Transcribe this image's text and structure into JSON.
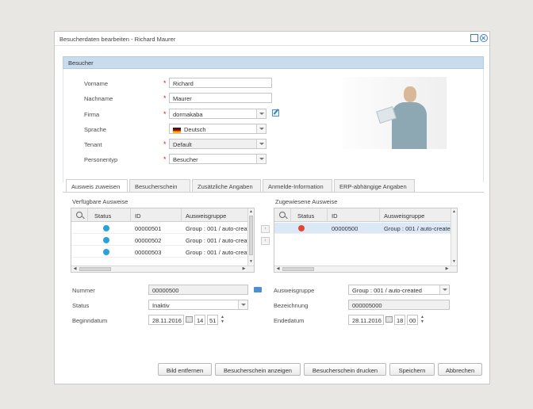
{
  "dialog": {
    "title": "Besucherdaten bearbeiten - Richard Maurer"
  },
  "section": {
    "title": "Besucher"
  },
  "form": {
    "vorname_label": "Vorname",
    "vorname_value": "Richard",
    "nachname_label": "Nachname",
    "nachname_value": "Maurer",
    "firma_label": "Firma",
    "firma_value": "dormakaba",
    "sprache_label": "Sprache",
    "sprache_value": "Deutsch",
    "tenant_label": "Tenant",
    "tenant_value": "Default",
    "personentyp_label": "Personentyp",
    "personentyp_value": "Besucher",
    "required_mark": "*"
  },
  "tabs": [
    {
      "label": "Ausweis zuweisen"
    },
    {
      "label": "Besucherschein"
    },
    {
      "label": "Zusätzliche Angaben"
    },
    {
      "label": "Anmelde-Information"
    },
    {
      "label": "ERP-abhängige Angaben"
    }
  ],
  "available": {
    "title": "Verfügbare Ausweise",
    "columns": [
      "Status",
      "ID",
      "Ausweisgruppe"
    ],
    "rows": [
      {
        "status_color": "#29a3d6",
        "id": "00000501",
        "group": "Group : 001 / auto-created"
      },
      {
        "status_color": "#29a3d6",
        "id": "00000502",
        "group": "Group : 001 / auto-created"
      },
      {
        "status_color": "#29a3d6",
        "id": "00000503",
        "group": "Group : 001 / auto-created"
      }
    ]
  },
  "assigned": {
    "title": "Zugewiesene Ausweise",
    "columns": [
      "Status",
      "ID",
      "Ausweisgruppe"
    ],
    "rows": [
      {
        "status_color": "#e0473a",
        "id": "00000500",
        "group": "Group : 001 / auto-created"
      }
    ]
  },
  "details": {
    "nummer_label": "Nummer",
    "nummer_value": "00000500",
    "status_label": "Status",
    "status_value": "Inaktiv",
    "beginn_label": "Beginndatum",
    "beginn_date": "28.11.2016",
    "beginn_hour": "14",
    "beginn_min": "51",
    "gruppe_label": "Ausweisgruppe",
    "gruppe_value": "Group : 001 / auto-created",
    "bezeichnung_label": "Bezeichnung",
    "bezeichnung_value": "000005000",
    "ende_label": "Endedatum",
    "ende_date": "28.11.2016",
    "ende_hour": "18",
    "ende_min": "00"
  },
  "footer": {
    "bild_entfernen": "Bild entfernen",
    "schein_anzeigen": "Besucherschein anzeigen",
    "schein_drucken": "Besucherschein drucken",
    "speichern": "Speichern",
    "abbrechen": "Abbrechen"
  },
  "icons": {
    "window": [
      "restore-icon",
      "close-icon"
    ],
    "grid": "search-icon",
    "edit": "edit-icon",
    "calendar": "calendar-icon",
    "card": "id-card-icon"
  }
}
